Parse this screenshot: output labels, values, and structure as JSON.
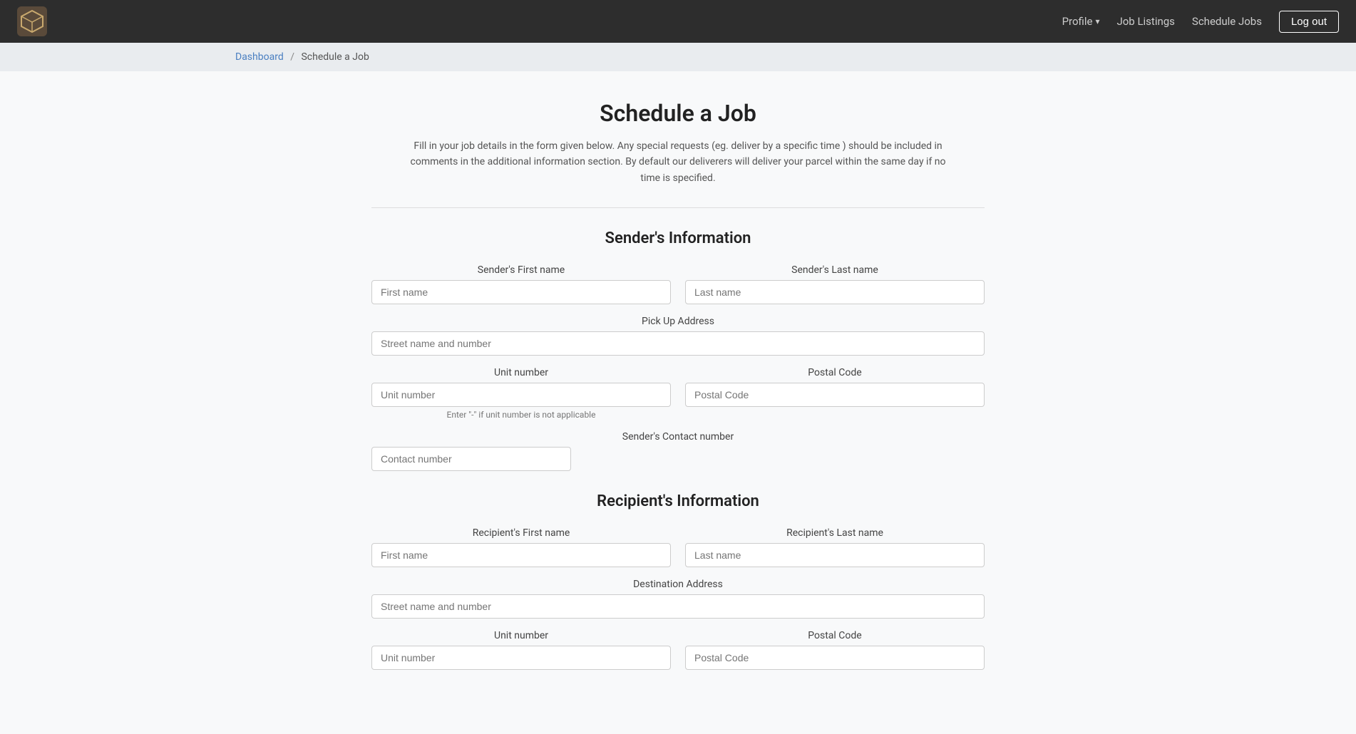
{
  "navbar": {
    "profile_label": "Profile",
    "job_listings_label": "Job Listings",
    "schedule_jobs_label": "Schedule Jobs",
    "logout_label": "Log out"
  },
  "breadcrumb": {
    "home_label": "Dashboard",
    "current_label": "Schedule a Job",
    "separator": "/"
  },
  "page": {
    "title": "Schedule a Job",
    "description": "Fill in your job details in the form given below. Any special requests (eg. deliver by a specific time ) should be included in comments in the additional information section. By default our deliverers will deliver your parcel within the same day if no time is specified."
  },
  "sender_section": {
    "title": "Sender's Information",
    "first_name_label": "Sender's First name",
    "first_name_placeholder": "First name",
    "last_name_label": "Sender's Last name",
    "last_name_placeholder": "Last name",
    "pickup_address_label": "Pick Up Address",
    "pickup_street_placeholder": "Street name and number",
    "unit_number_label": "Unit number",
    "unit_number_placeholder": "Unit number",
    "postal_code_label": "Postal Code",
    "postal_code_placeholder": "Postal Code",
    "unit_hint": "Enter \"-\" if unit number is not applicable",
    "contact_label": "Sender's Contact number",
    "contact_placeholder": "Contact number"
  },
  "recipient_section": {
    "title": "Recipient's Information",
    "first_name_label": "Recipient's First name",
    "first_name_placeholder": "First name",
    "last_name_label": "Recipient's Last name",
    "last_name_placeholder": "Last name",
    "destination_address_label": "Destination Address",
    "destination_street_placeholder": "Street name and number",
    "unit_number_label": "Unit number",
    "unit_number_placeholder": "Unit number",
    "postal_code_label": "Postal Code",
    "postal_code_placeholder": "Postal Code"
  }
}
